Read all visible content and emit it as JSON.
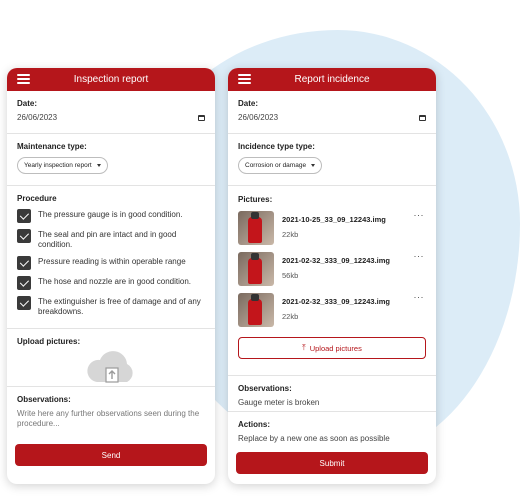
{
  "left": {
    "title": "Inspection report",
    "date_label": "Date:",
    "date_value": "26/06/2023",
    "maintenance_label": "Maintenance type:",
    "maintenance_value": "Yearly inspection report",
    "procedure_label": "Procedure",
    "procedure_items": [
      "The pressure gauge is in good condition.",
      "The seal and pin are intact and in good condition.",
      "Pressure reading is within operable range",
      "The hose and nozzle are in good condition.",
      "The extinguisher is free of damage and of any breakdowns."
    ],
    "upload_label": "Upload pictures:",
    "observations_label": "Observations:",
    "observations_placeholder": "Write here any further observations seen during the procedure...",
    "send_label": "Send"
  },
  "right": {
    "title": "Report incidence",
    "date_label": "Date:",
    "date_value": "26/06/2023",
    "incidence_label": "Incidence type type:",
    "incidence_value": "Corrosion or damage",
    "pictures_label": "Pictures:",
    "pictures": [
      {
        "name": "2021-10-25_33_09_12243.img",
        "size": "22kb"
      },
      {
        "name": "2021-02-32_333_09_12243.img",
        "size": "56kb"
      },
      {
        "name": "2021-02-32_333_09_12243.img",
        "size": "22kb"
      }
    ],
    "upload_button_label": "Upload pictures",
    "observations_label": "Observations:",
    "observations_value": "Gauge meter is broken",
    "actions_label": "Actions:",
    "actions_value": "Replace by a new one as soon as possible",
    "submit_label": "Submit"
  },
  "colors": {
    "accent": "#b5161b",
    "background_blob": "#dcecf7"
  },
  "icons": [
    "menu-icon",
    "calendar-icon",
    "chevron-down-icon",
    "checkbox-checked-icon",
    "cloud-upload-icon",
    "upload-icon",
    "more-icon"
  ]
}
